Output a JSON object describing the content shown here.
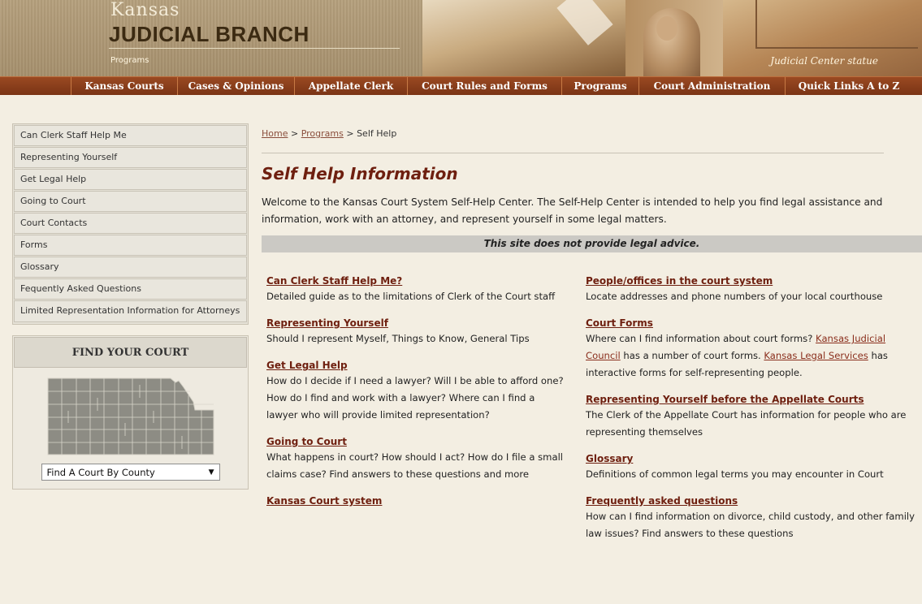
{
  "header": {
    "site_name_top": "Kansas",
    "site_name_main": "JUDICIAL BRANCH",
    "section": "Programs",
    "photo_caption": "Judicial Center statue"
  },
  "nav": {
    "items": [
      {
        "label": "Kansas Courts"
      },
      {
        "label": "Cases & Opinions"
      },
      {
        "label": "Appellate Clerk"
      },
      {
        "label": "Court Rules and Forms"
      },
      {
        "label": "Programs"
      },
      {
        "label": "Court Administration"
      },
      {
        "label": "Quick Links A to Z"
      }
    ]
  },
  "sidebar": {
    "items": [
      {
        "label": "Can Clerk Staff Help Me"
      },
      {
        "label": "Representing Yourself"
      },
      {
        "label": "Get Legal Help"
      },
      {
        "label": "Going to Court"
      },
      {
        "label": "Court Contacts"
      },
      {
        "label": "Forms"
      },
      {
        "label": "Glossary"
      },
      {
        "label": "Fequently Asked Questions"
      },
      {
        "label": "Limited Representation Information for Attorneys"
      }
    ],
    "find_court": {
      "title": "FIND YOUR COURT",
      "select_value": "Find A Court By County"
    }
  },
  "breadcrumb": {
    "home": "Home",
    "sep1": ">",
    "programs": "Programs",
    "sep2": ">",
    "current": "Self Help"
  },
  "main": {
    "title": "Self Help Information",
    "intro": "Welcome to the Kansas Court System Self-Help Center. The Self-Help Center is intended to help you find legal assistance and information, work with an attorney, and represent yourself in some legal matters.",
    "notice": "This site does not provide legal advice.",
    "left_entries": [
      {
        "title": "Can Clerk Staff Help Me?",
        "desc": "Detailed guide as to the limitations of Clerk of the Court staff"
      },
      {
        "title": "Representing Yourself",
        "desc": "Should I represent Myself, Things to Know, General Tips"
      },
      {
        "title": "Get Legal Help",
        "desc": "How do I decide if I need a lawyer? Will I be able to afford one? How do I find and work with a lawyer? Where can I find a lawyer who will provide limited representation?"
      },
      {
        "title": "Going to Court",
        "desc": "What happens in court? How should I act? How do I file a small claims case? Find answers to these questions and more"
      },
      {
        "title": "Kansas Court system",
        "desc": ""
      }
    ],
    "right_entries": [
      {
        "title": "People/offices in the court system",
        "desc": "Locate addresses and phone numbers of your local courthouse"
      },
      {
        "title": "Court Forms",
        "desc_before": "Where can I find information about court forms? ",
        "link1": "Kansas Judicial Council",
        "desc_middle": " has a number of court forms. ",
        "link2": "Kansas Legal Services",
        "desc_after": " has interactive forms for self-representing people."
      },
      {
        "title": "Representing Yourself before the Appellate Courts",
        "desc": "The Clerk of the Appellate Court has information for people who are representing themselves"
      },
      {
        "title": "Glossary",
        "desc": "Definitions of common legal terms you may encounter in Court"
      },
      {
        "title": "Frequently asked questions",
        "desc": "How can I find information on divorce, child custody, and other family law issues? Find answers to these questions"
      }
    ]
  },
  "colors": {
    "nav_bg": "#8a3f1c",
    "title_color": "#6e1f0f",
    "page_bg": "#f3eee2"
  }
}
